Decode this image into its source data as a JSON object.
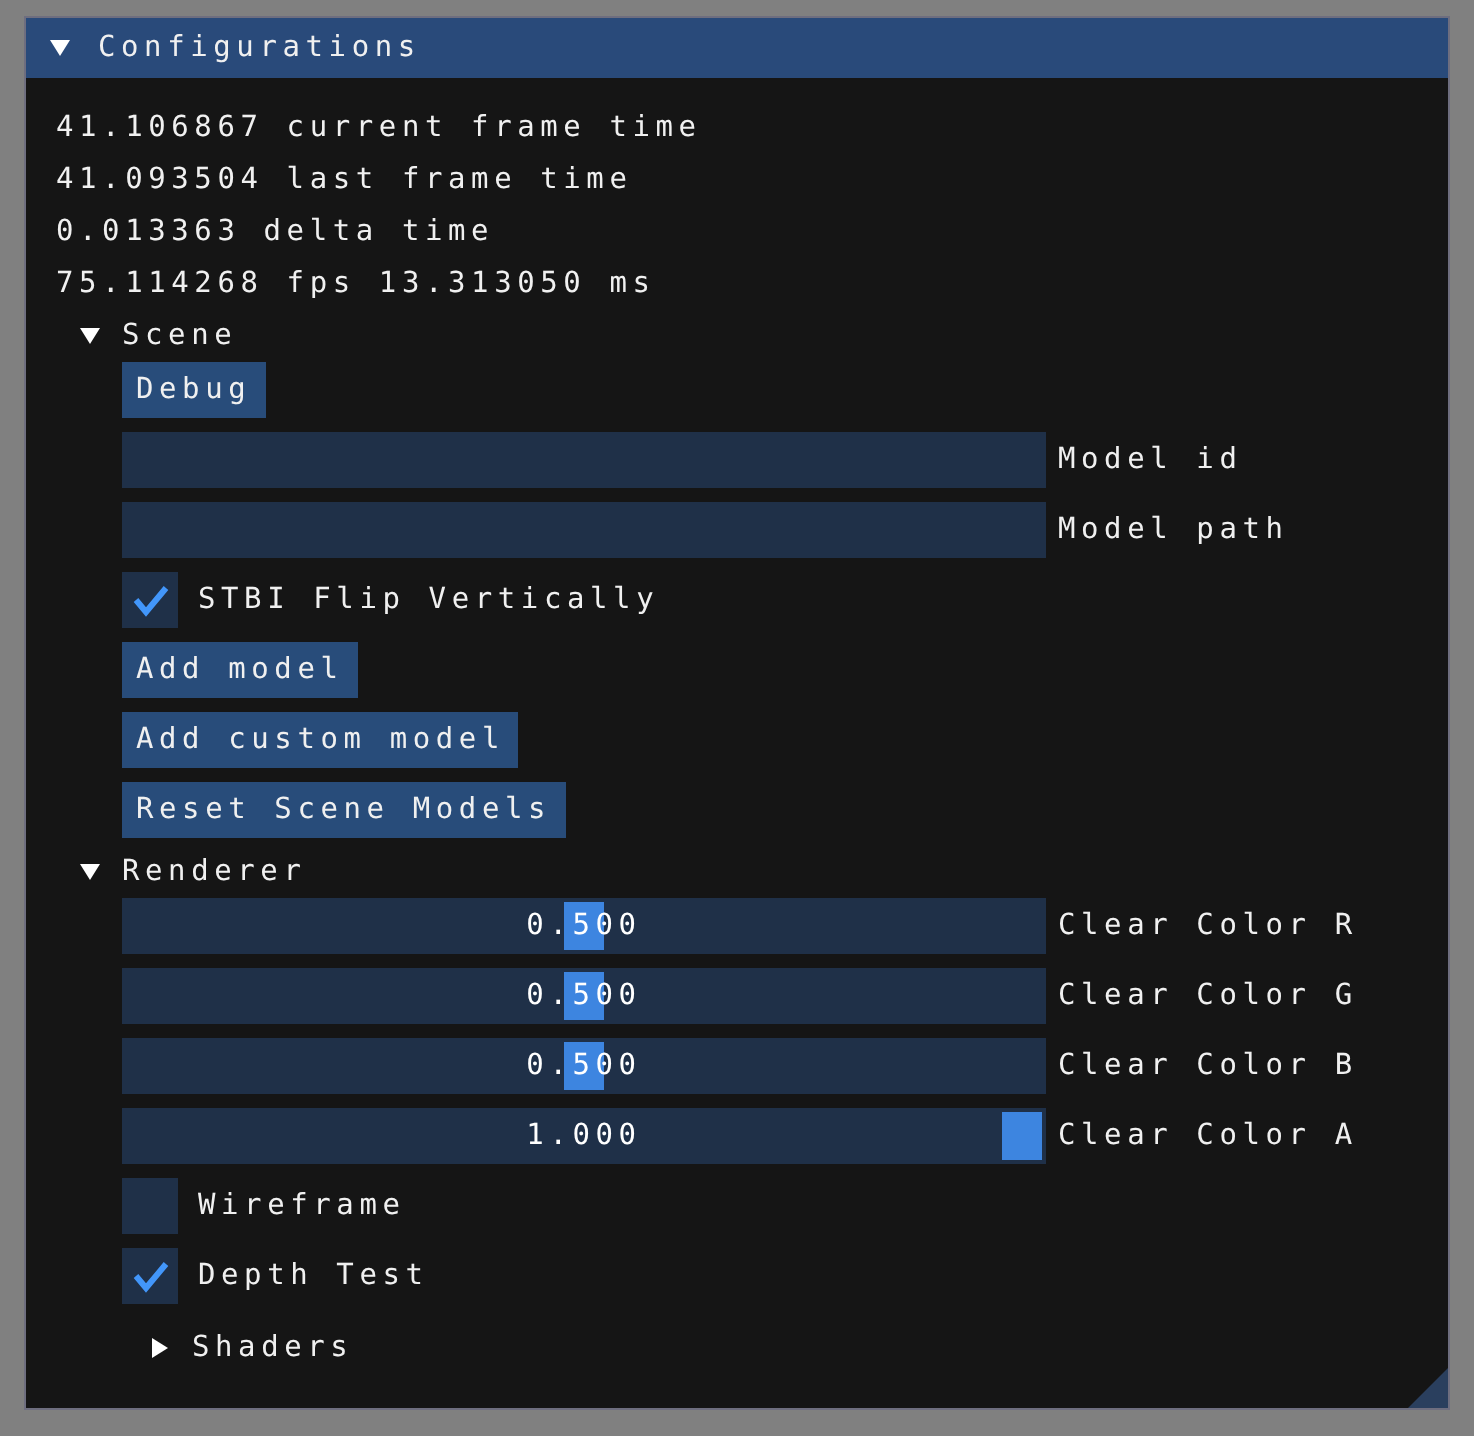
{
  "window": {
    "title": "Configurations",
    "expanded": true
  },
  "stats": [
    "41.106867 current frame time",
    "41.093504 last frame time",
    "0.013363 delta time",
    "75.114268 fps 13.313050 ms"
  ],
  "sections": [
    {
      "label": "Scene",
      "expanded": true,
      "items": [
        {
          "kind": "button",
          "label": "Debug"
        },
        {
          "kind": "input",
          "label": "Model id"
        },
        {
          "kind": "input",
          "label": "Model path"
        },
        {
          "kind": "checkbox",
          "label": "STBI Flip Vertically",
          "checked": true
        },
        {
          "kind": "button",
          "label": "Add model"
        },
        {
          "kind": "button",
          "label": "Add custom model"
        },
        {
          "kind": "button",
          "label": "Reset Scene Models"
        }
      ]
    },
    {
      "label": "Renderer",
      "expanded": true,
      "items": [
        {
          "kind": "slider",
          "label": "Clear Color R",
          "value": "0.500",
          "level": 0.5
        },
        {
          "kind": "slider",
          "label": "Clear Color G",
          "value": "0.500",
          "level": 0.5
        },
        {
          "kind": "slider",
          "label": "Clear Color B",
          "value": "0.500",
          "level": 0.5
        },
        {
          "kind": "slider",
          "label": "Clear Color A",
          "value": "1.000",
          "level": 1
        },
        {
          "kind": "checkbox",
          "label": "Wireframe",
          "checked": false
        },
        {
          "kind": "checkbox",
          "label": "Depth Test",
          "checked": true
        },
        {
          "kind": "tree",
          "label": "Shaders",
          "expanded": false
        }
      ]
    }
  ]
}
